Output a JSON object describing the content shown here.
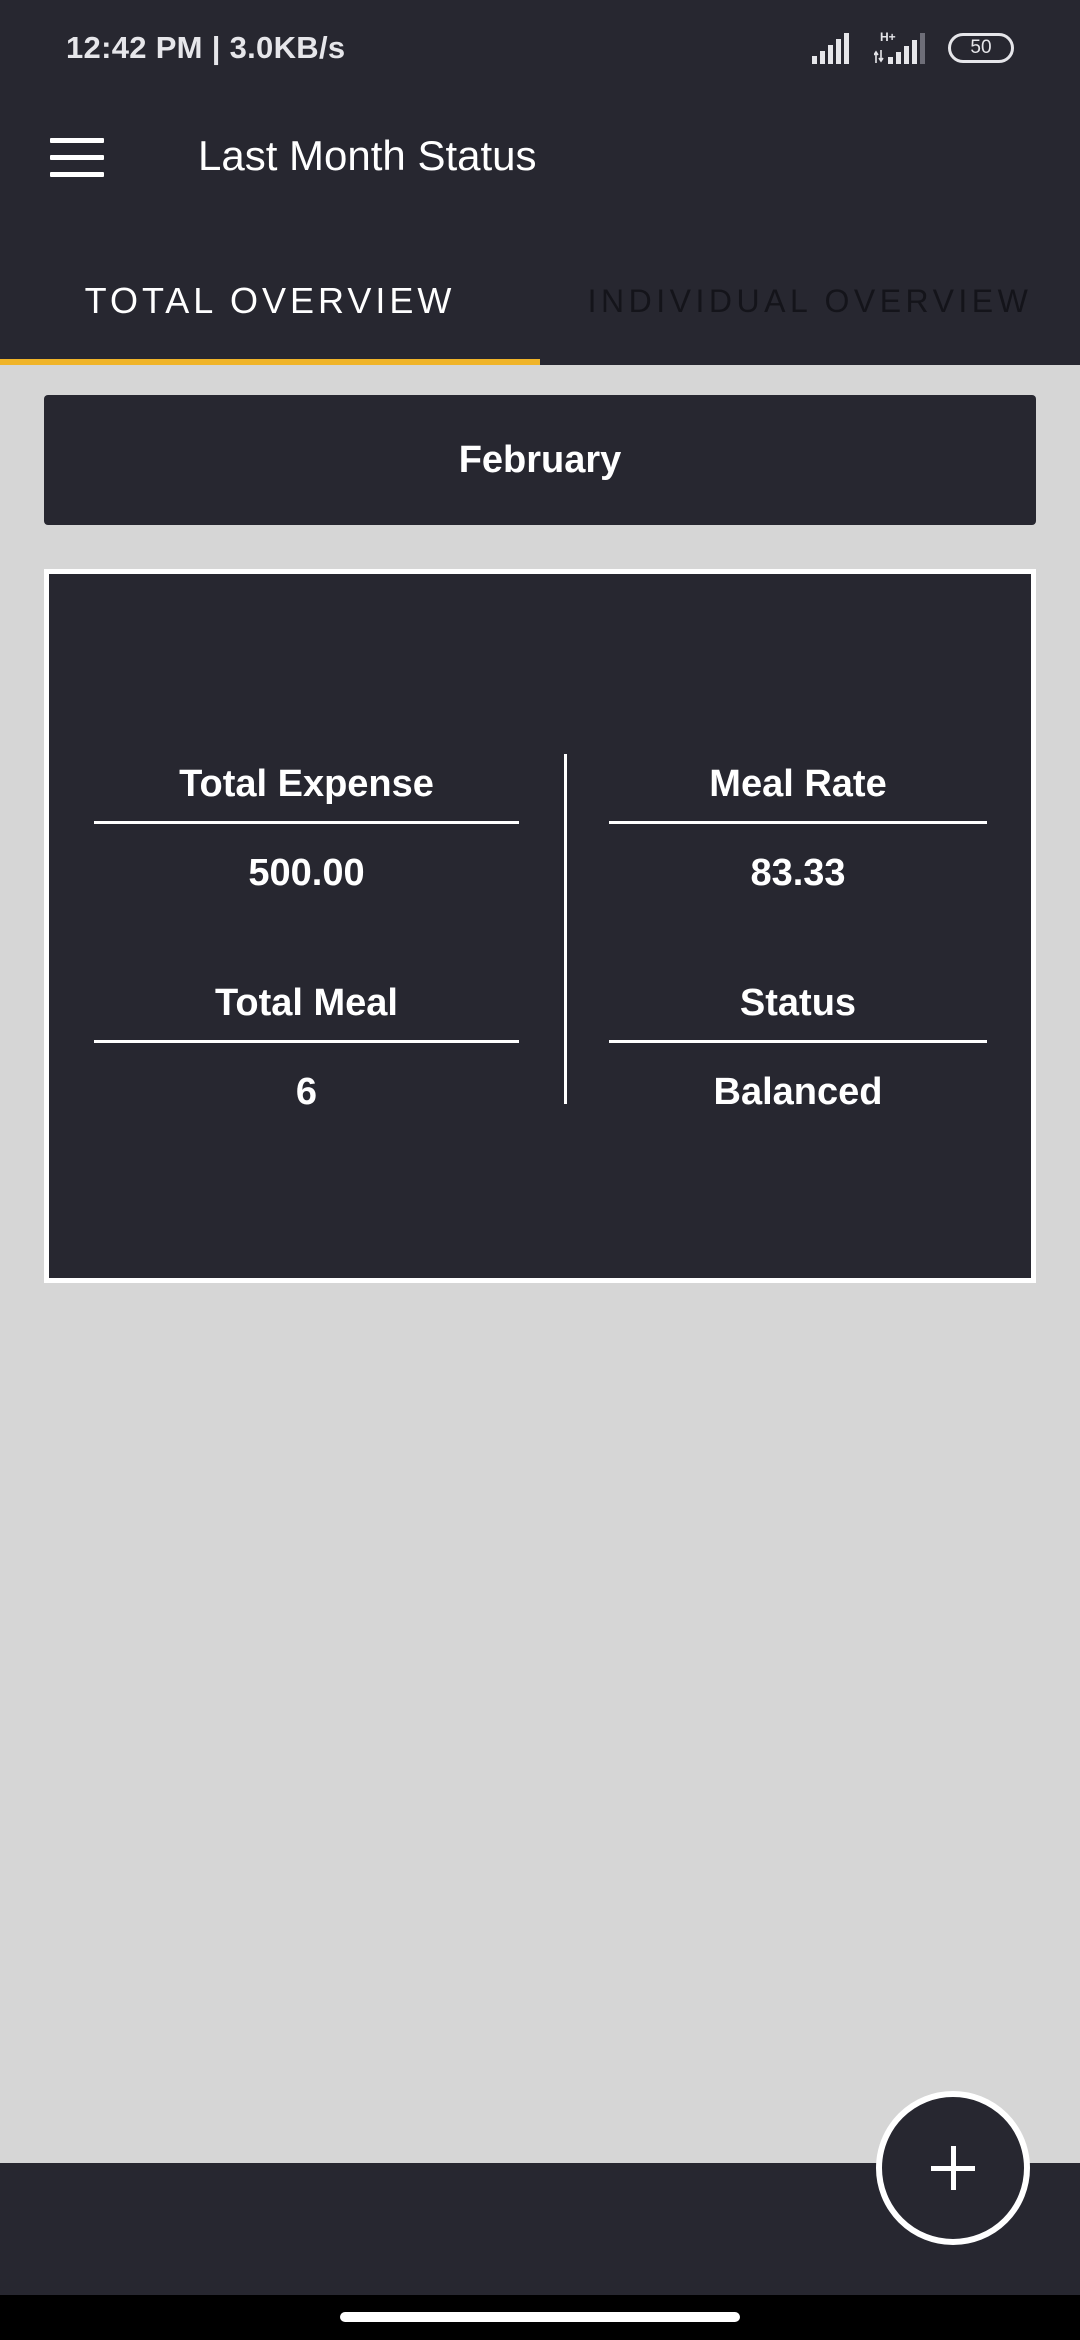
{
  "status_bar": {
    "time_speed": "12:42 PM | 3.0KB/s",
    "network_type": "H+",
    "battery": "50"
  },
  "app_bar": {
    "title": "Last Month Status",
    "menu_icon": "hamburger-menu-icon"
  },
  "tabs": [
    {
      "label": "TOTAL OVERVIEW",
      "selected": true
    },
    {
      "label": "INDIVIDUAL OVERVIEW",
      "selected": false
    }
  ],
  "colors": {
    "primary_dark": "#272730",
    "background": "#d6d6d6",
    "tab_indicator": "#f0b429"
  },
  "month": "February",
  "summary": {
    "total_expense": {
      "label": "Total Expense",
      "value": "500.00"
    },
    "meal_rate": {
      "label": "Meal Rate",
      "value": "83.33"
    },
    "total_meal": {
      "label": "Total Meal",
      "value": "6"
    },
    "status": {
      "label": "Status",
      "value": "Balanced"
    }
  },
  "fab": {
    "icon": "plus-icon"
  }
}
